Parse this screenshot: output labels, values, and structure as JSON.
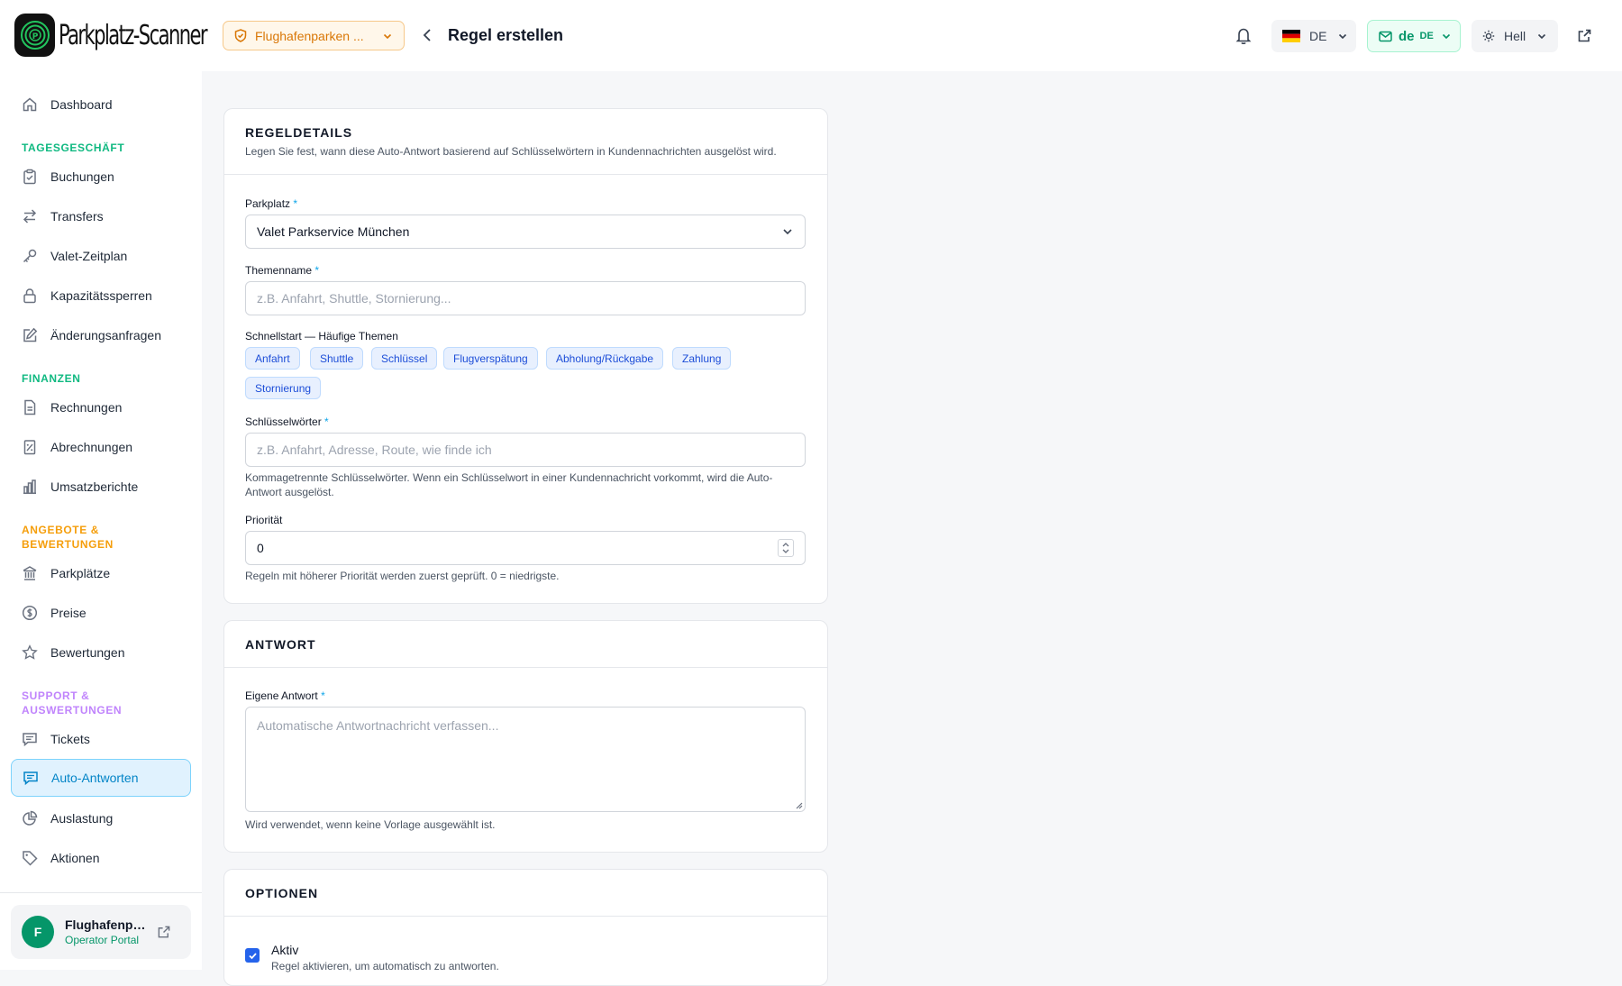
{
  "app": {
    "logo_text": "Parkplatz-Scanner",
    "location_selector": "Flughafenparken ...",
    "page_title": "Regel erstellen"
  },
  "topbar": {
    "language": "DE",
    "mail_language": "de",
    "mail_language_badge": "DE",
    "theme": "Hell"
  },
  "colors": {
    "brand_green": "#059669",
    "accent_blue": "#0ea5e9",
    "warning_orange": "#d97706"
  },
  "sidebar": {
    "dashboard": "Dashboard",
    "sections": [
      {
        "title": "TAGESGESCHÄFT",
        "color": "#10b981",
        "items": [
          "Buchungen",
          "Transfers",
          "Valet-Zeitplan",
          "Kapazitätssperren",
          "Änderungsanfragen"
        ]
      },
      {
        "title": "FINANZEN",
        "color": "#10b981",
        "items": [
          "Rechnungen",
          "Abrechnungen",
          "Umsatzberichte"
        ]
      },
      {
        "title_line1": "ANGEBOTE &",
        "title_line2": "BEWERTUNGEN",
        "color": "#f59e0b",
        "items": [
          "Parkplätze",
          "Preise",
          "Bewertungen"
        ]
      },
      {
        "title_line1": "SUPPORT &",
        "title_line2": "AUSWERTUNGEN",
        "color": "#c084fc",
        "items": [
          "Tickets",
          "Auto-Antworten",
          "Auslastung",
          "Aktionen"
        ]
      }
    ],
    "active_item": "Auto-Antworten",
    "user": {
      "initial": "F",
      "name": "Flughafenpar...",
      "role": "Operator Portal"
    }
  },
  "rule_details": {
    "title": "REGELDETAILS",
    "subtitle": "Legen Sie fest, wann diese Auto-Antwort basierend auf Schlüsselwörtern in Kundennachrichten ausgelöst wird.",
    "parkplatz_label": "Parkplatz",
    "parkplatz_value": "Valet Parkservice München",
    "topic_label": "Themenname",
    "topic_placeholder": "z.B. Anfahrt, Shuttle, Stornierung...",
    "quickstart_label": "Schnellstart — Häufige Themen",
    "chips": [
      "Anfahrt",
      "Shuttle",
      "Schlüssel",
      "Flugverspätung",
      "Abholung/Rückgabe",
      "Zahlung",
      "Stornierung"
    ],
    "keywords_label": "Schlüsselwörter",
    "keywords_placeholder": "z.B. Anfahrt, Adresse, Route, wie finde ich",
    "keywords_help": "Kommagetrennte Schlüsselwörter. Wenn ein Schlüsselwort in einer Kundennachricht vorkommt, wird die Auto-Antwort ausgelöst.",
    "priority_label": "Priorität",
    "priority_value": "0",
    "priority_help": "Regeln mit höherer Priorität werden zuerst geprüft. 0 = niedrigste."
  },
  "answer": {
    "title": "ANTWORT",
    "own_label": "Eigene Antwort",
    "own_placeholder": "Automatische Antwortnachricht verfassen...",
    "own_help": "Wird verwendet, wenn keine Vorlage ausgewählt ist."
  },
  "options": {
    "title": "OPTIONEN",
    "active_label": "Aktiv",
    "active_checked": true,
    "active_help": "Regel aktivieren, um automatisch zu antworten."
  },
  "common": {
    "required_mark": "*"
  }
}
